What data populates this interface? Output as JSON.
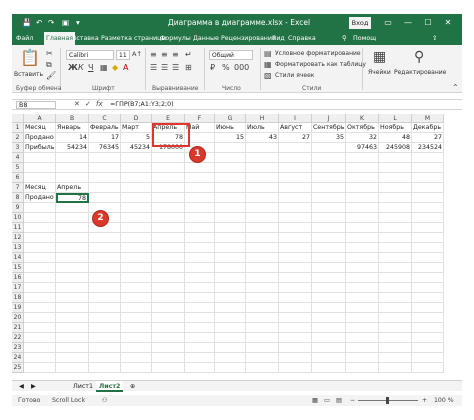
{
  "window": {
    "title": "Диаграмма в диаграмме.xlsx - Excel",
    "signin": "Вход",
    "search": "Помощ"
  },
  "tabs": [
    "Файл",
    "Главная",
    "Вставка",
    "Разметка страницы",
    "Формулы",
    "Данные",
    "Рецензирование",
    "Вид",
    "Справка"
  ],
  "ribbon": {
    "paste_label": "Вставить",
    "font_name": "Calibri",
    "font_size": "11",
    "number_format": "Общий",
    "cond_format": "Условное форматирование",
    "table_format": "Форматировать как таблицу",
    "cell_styles": "Стили ячеек",
    "cells_label": "Ячейки",
    "editing_label": "Редактирование",
    "groups": [
      "Буфер обмена",
      "Шрифт",
      "Выравнивание",
      "Число",
      "Стили"
    ]
  },
  "formula_bar": {
    "name_box": "B8",
    "formula": "=ГПР(B7;A1:Y3;2;0)"
  },
  "columns": [
    "A",
    "B",
    "C",
    "D",
    "E",
    "F",
    "G",
    "H",
    "I",
    "J",
    "K",
    "L",
    "M"
  ],
  "rows": [
    "1",
    "2",
    "3",
    "4",
    "5",
    "6",
    "7",
    "8",
    "9",
    "10",
    "11",
    "12",
    "13",
    "14",
    "15",
    "16",
    "17",
    "18",
    "19",
    "20",
    "21",
    "22",
    "23",
    "24",
    "25"
  ],
  "table": {
    "row1": [
      "Месяц",
      "Январь",
      "Февраль",
      "Март",
      "Апрель",
      "Май",
      "Июнь",
      "Июль",
      "Август",
      "Сентябрь",
      "Октябрь",
      "Ноябрь",
      "Декабрь"
    ],
    "row2": [
      "Продано",
      "14",
      "17",
      "5",
      "78",
      "",
      "15",
      "43",
      "27",
      "35",
      "32",
      "48",
      "27"
    ],
    "row3": [
      "Прибыль",
      "54234",
      "76345",
      "45234",
      "178000",
      "",
      "",
      "",
      "",
      "",
      "97463",
      "245908",
      "234524"
    ]
  },
  "lookup": {
    "label1": "Месяц",
    "value1": "Апрель",
    "label2": "Продано",
    "value2": "78"
  },
  "callouts": [
    "1",
    "2"
  ],
  "sheets": [
    "Лист1",
    "Лист2"
  ],
  "status": {
    "ready": "Готово",
    "scroll": "Scroll Lock",
    "zoom": "100 %"
  },
  "colors": {
    "accent": "#217346",
    "callout": "#d8392b"
  }
}
